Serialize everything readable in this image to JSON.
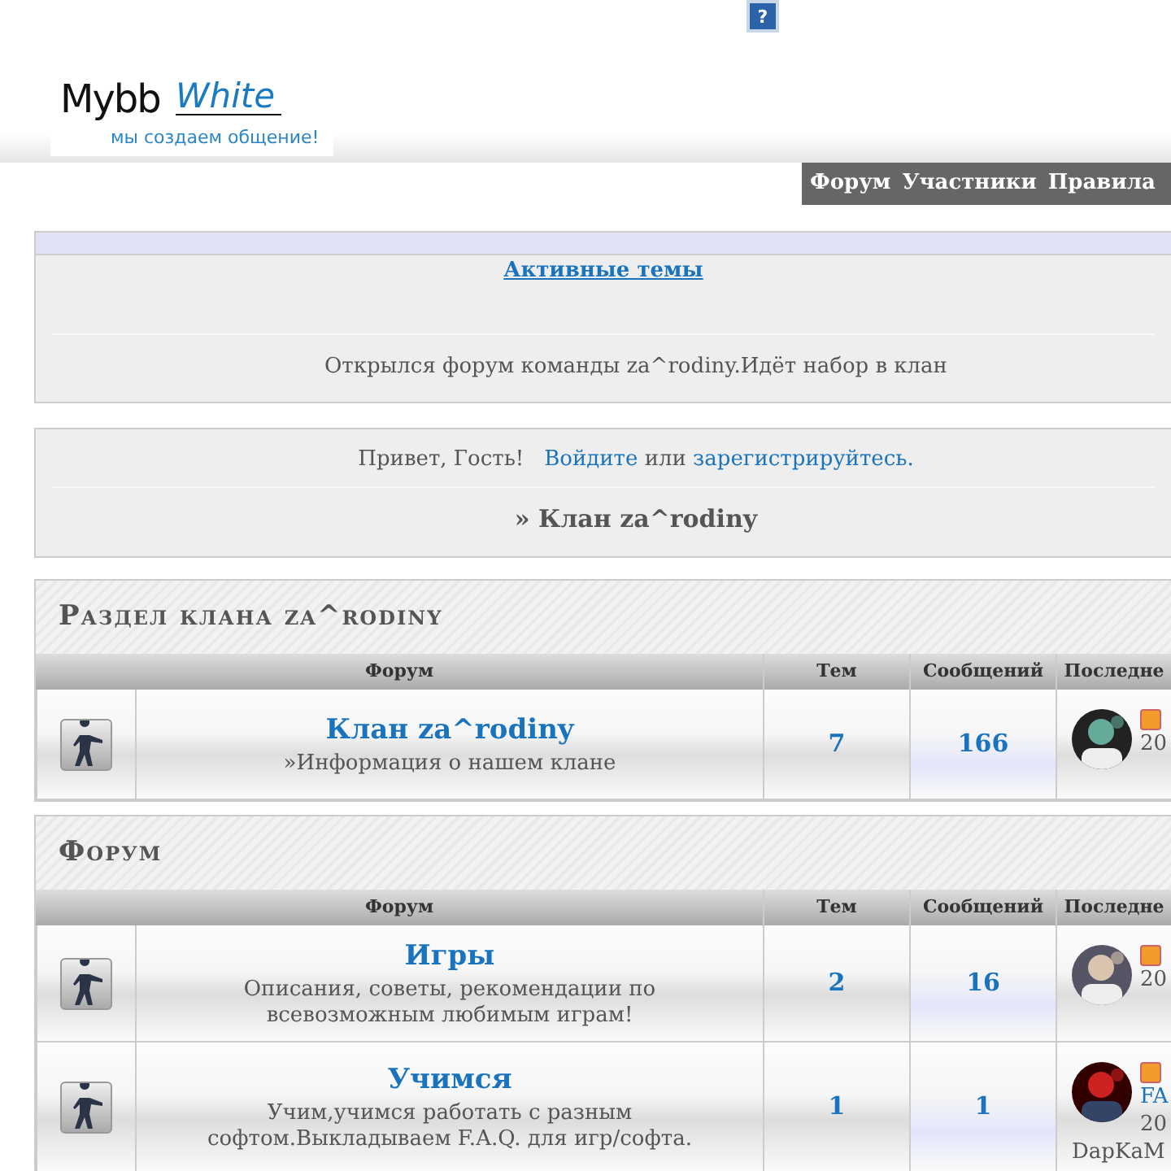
{
  "header": {
    "help_icon": "?",
    "logo": {
      "part_1": "Mybb",
      "part_2": "White",
      "slogan": "мы создаем общение!"
    },
    "nav": [
      {
        "label": "Форум"
      },
      {
        "label": "Участники"
      },
      {
        "label": "Правила"
      }
    ]
  },
  "announcement": {
    "link": "Активные темы",
    "text": "Открылся форум команды za^rodiny.Идёт набор в клан"
  },
  "welcome": {
    "greeting": "Привет, Гость!",
    "login": "Войдите",
    "or": "или",
    "register": "зарегистрируйтесь.",
    "breadcrumb": "» Клан za^rodiny"
  },
  "sections": [
    {
      "title": "Раздел клана za^rodiny",
      "columns": [
        "Форум",
        "Тем",
        "Сообщений",
        "Последне"
      ],
      "rows": [
        {
          "name": "Клан za^rodiny",
          "description": "»Информация о нашем клане",
          "topics": "7",
          "posts": "166",
          "last_post": [
            "20"
          ],
          "avatar": {
            "kind": "picture"
          }
        }
      ]
    },
    {
      "title": "Форум",
      "columns": [
        "Форум",
        "Тем",
        "Сообщений",
        "Последне"
      ],
      "rows": [
        {
          "name": "Игры",
          "description": "Описания, советы, рекомендации по всевозможным любимым играм!",
          "topics": "2",
          "posts": "16",
          "last_post": [
            "20"
          ],
          "avatar": {
            "kind": "picture"
          }
        },
        {
          "name": "Учимся",
          "description": "Учим,учимся работать с разным софтом.Выкладываем F.A.Q. для игр/софта.",
          "topics": "1",
          "posts": "1",
          "last_post": [
            "FA",
            "20",
            "DapKaM"
          ],
          "avatar": {
            "kind": "picture"
          }
        }
      ]
    }
  ]
}
